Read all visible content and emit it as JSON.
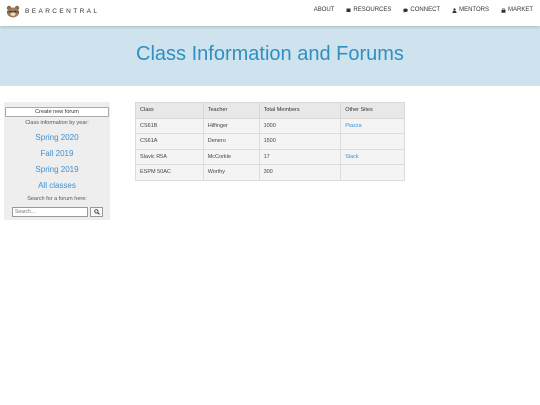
{
  "navbar": {
    "brand": "BEARCENTRAL",
    "items": [
      {
        "label": "ABOUT",
        "icon": ""
      },
      {
        "label": "RESOURCES",
        "icon": "book-icon"
      },
      {
        "label": "CONNECT",
        "icon": "chat-icon"
      },
      {
        "label": "MENTORS",
        "icon": "person-icon"
      },
      {
        "label": "MARKET",
        "icon": "bag-icon"
      }
    ]
  },
  "hero": {
    "title": "Class Information and Forums",
    "background": "#cfe3ee",
    "title_color": "#2f8fc2"
  },
  "sidebar": {
    "new_forum_label": "Create new forum",
    "class_info_caption": "Class information by year:",
    "years": [
      "Spring 2020",
      "Fall 2019",
      "Spring 2019",
      "All classes"
    ],
    "search_caption": "Search for a forum here:",
    "search_placeholder": "Search..."
  },
  "table": {
    "headers": [
      "Class",
      "Teacher",
      "Total Members",
      "Other Sites"
    ],
    "rows": [
      {
        "class": "CS61B",
        "teacher": "Hilfinger",
        "members": "1000",
        "site": "Piazza"
      },
      {
        "class": "CS61A",
        "teacher": "Denero",
        "members": "1500",
        "site": ""
      },
      {
        "class": "Slavic R5A",
        "teacher": "McCorkle",
        "members": "17",
        "site": "Slack"
      },
      {
        "class": "ESPM 50AC",
        "teacher": "Worthy",
        "members": "300",
        "site": ""
      }
    ]
  },
  "colors": {
    "link": "#3d8fd1"
  }
}
